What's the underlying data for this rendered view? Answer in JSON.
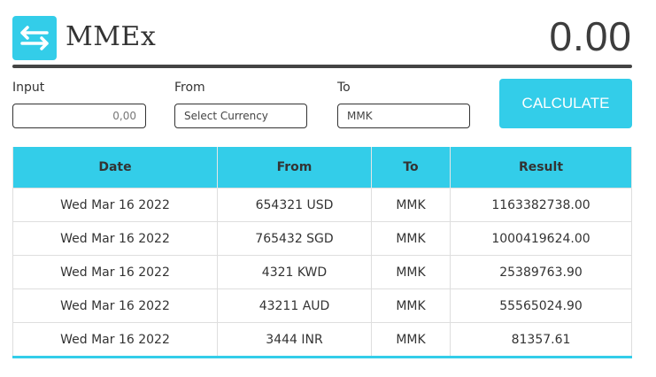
{
  "app": {
    "title": "MMEx",
    "display_value": "0.00",
    "accent_color": "#33cde9"
  },
  "logo": {
    "icon": "exchange-arrows-icon"
  },
  "form": {
    "input_label": "Input",
    "input_placeholder": "0,00",
    "from_label": "From",
    "from_value": "Select Currency",
    "to_label": "To",
    "to_value": "MMK",
    "calculate_label": "CALCULATE"
  },
  "table": {
    "headers": [
      "Date",
      "From",
      "To",
      "Result"
    ],
    "rows": [
      [
        "Wed Mar 16 2022",
        "654321 USD",
        "MMK",
        "1163382738.00"
      ],
      [
        "Wed Mar 16 2022",
        "765432 SGD",
        "MMK",
        "1000419624.00"
      ],
      [
        "Wed Mar 16 2022",
        "4321 KWD",
        "MMK",
        "25389763.90"
      ],
      [
        "Wed Mar 16 2022",
        "43211 AUD",
        "MMK",
        "55565024.90"
      ],
      [
        "Wed Mar 16 2022",
        "3444 INR",
        "MMK",
        "81357.61"
      ]
    ]
  }
}
